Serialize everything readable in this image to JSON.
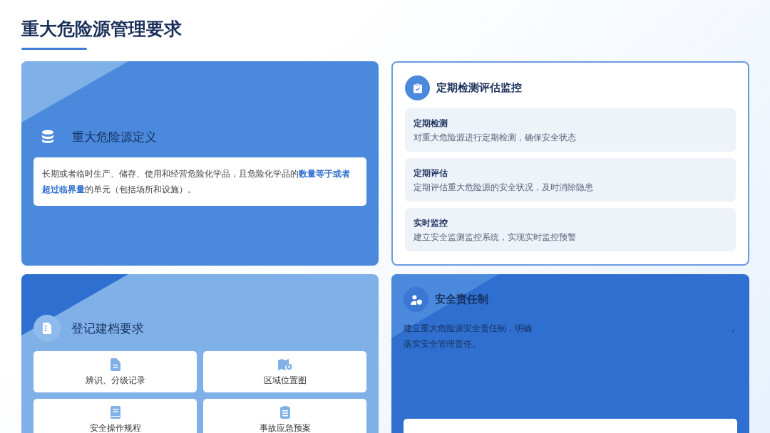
{
  "title": "重大危险源管理要求",
  "definition": {
    "title": "重大危险源定义",
    "text": "长期或者临时生产、储存、使用和经营危险化学品，且危险化学品的**数量等于或者超过临界量**的单元（包括场所和设施）。"
  },
  "inspection": {
    "title": "定期检测评估监控",
    "items": [
      {
        "title": "定期检测",
        "text": "对重大危险源进行定期检测，确保安全状态"
      },
      {
        "title": "定期评估",
        "text": "定期评估重大危险源的安全状况，及时消除隐患"
      },
      {
        "title": "实时监控",
        "text": "建立安全监测监控系统，实现实时监控预警"
      }
    ]
  },
  "registration": {
    "title": "登记建档要求",
    "items": [
      {
        "label": "辨识、分级记录",
        "kind": "document"
      },
      {
        "label": "区域位置图",
        "kind": "map"
      },
      {
        "label": "安全操作规程",
        "kind": "book"
      },
      {
        "label": "事故应急预案",
        "kind": "checklist"
      }
    ]
  },
  "responsibility": {
    "title": "安全责任制",
    "lines": [
      "建立重大危险源安全责任制，明确",
      "落实安全管理责任。"
    ],
    "stray_mark": "，"
  }
}
